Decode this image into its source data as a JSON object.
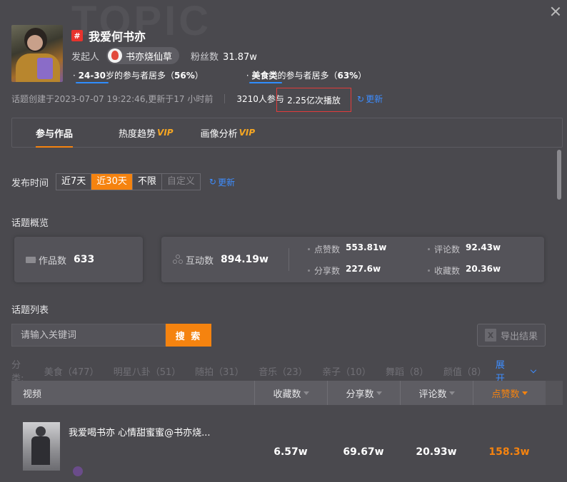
{
  "watermark": "TOPIC",
  "topic": {
    "title": "我爱何书亦",
    "hash_symbol": "#",
    "initiator_label": "发起人",
    "initiator_name": "书亦烧仙草",
    "fans_label": "粉丝数",
    "fans_value": "31.87w",
    "tags": [
      {
        "prefix": "· ",
        "highlight": "24-30",
        "mid": "岁的参与者居多（",
        "pct": "56%",
        "suffix": "）"
      },
      {
        "prefix": "· ",
        "highlight": "美食类",
        "mid": "的参与者居多（",
        "pct": "63%",
        "suffix": "）"
      }
    ],
    "meta_created": "话题创建于2023-07-07 19:22:46,更新于17 小时前",
    "meta_participants": "3210人参与",
    "meta_plays": "2.25亿次播放",
    "refresh_label": "更新"
  },
  "tabs": [
    {
      "label": "参与作品",
      "vip": ""
    },
    {
      "label": "热度趋势",
      "vip": "VIP"
    },
    {
      "label": "画像分析",
      "vip": "VIP"
    }
  ],
  "date_filter": {
    "label": "发布时间",
    "options": [
      "近7天",
      "近30天",
      "不限",
      "自定义"
    ],
    "selected": "近30天",
    "refresh_label": "更新"
  },
  "overview": {
    "title": "话题概览",
    "works_label": "作品数",
    "works_value": "633",
    "interact_label": "互动数",
    "interact_value": "894.19w",
    "likes_label": "点赞数",
    "likes_value": "553.81w",
    "comments_label": "评论数",
    "comments_value": "92.43w",
    "shares_label": "分享数",
    "shares_value": "227.6w",
    "favs_label": "收藏数",
    "favs_value": "20.36w"
  },
  "list": {
    "title": "话题列表",
    "search_placeholder": "请输入关键词",
    "search_label": "搜 索",
    "export_label": "导出结果",
    "export_icon_text": "X",
    "category_label": "分类:",
    "categories": [
      "美食（477）",
      "明星八卦（51）",
      "随拍（31）",
      "音乐（23）",
      "亲子（10）",
      "舞蹈（8）",
      "颜值（8）"
    ],
    "expand_label": "展开",
    "headers": {
      "video": "视频",
      "favs": "收藏数",
      "shares": "分享数",
      "comments": "评论数",
      "likes": "点赞数"
    },
    "rows": [
      {
        "title": "我爱喝书亦 心情甜蜜蜜@书亦烧...",
        "favs": "6.57w",
        "shares": "69.67w",
        "comments": "20.93w",
        "likes": "158.3w"
      }
    ]
  },
  "colors": {
    "accent": "#f5830f",
    "link": "#3d8dff",
    "highlight_border": "#e23b3b",
    "hash_red": "#e8332d"
  }
}
